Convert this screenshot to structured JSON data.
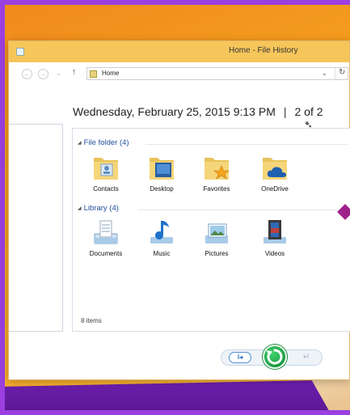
{
  "window": {
    "title": "Home - File History"
  },
  "address": {
    "path": "Home",
    "dropdown_glyph": "⌄",
    "refresh_glyph": "↻"
  },
  "nav": {
    "back_glyph": "←",
    "forward_glyph": "→",
    "recent_glyph": "⌄",
    "up_glyph": "↑"
  },
  "snapshot": {
    "date": "Wednesday, February 25, 2015 9:13 PM",
    "separator": "|",
    "position": "2 of 2"
  },
  "groups": [
    {
      "header": "File folder (4)",
      "items": [
        {
          "label": "Contacts",
          "icon": "contacts-folder-icon"
        },
        {
          "label": "Desktop",
          "icon": "desktop-folder-icon"
        },
        {
          "label": "Favorites",
          "icon": "favorites-folder-icon"
        },
        {
          "label": "OneDrive",
          "icon": "onedrive-folder-icon"
        }
      ]
    },
    {
      "header": "Library (4)",
      "items": [
        {
          "label": "Documents",
          "icon": "documents-library-icon"
        },
        {
          "label": "Music",
          "icon": "music-library-icon"
        },
        {
          "label": "Pictures",
          "icon": "pictures-library-icon"
        },
        {
          "label": "Videos",
          "icon": "videos-library-icon"
        }
      ]
    }
  ],
  "status": {
    "item_count": "8 items"
  },
  "pager": {
    "prev_glyph": "I◂",
    "next_glyph": "▸I"
  },
  "colors": {
    "titlebar": "#f6c65a",
    "restore_green": "#1d9c44",
    "accent_blue": "#1f4e9a",
    "desktop_purple": "#6a16b8",
    "desktop_orange": "#f5a11f"
  }
}
